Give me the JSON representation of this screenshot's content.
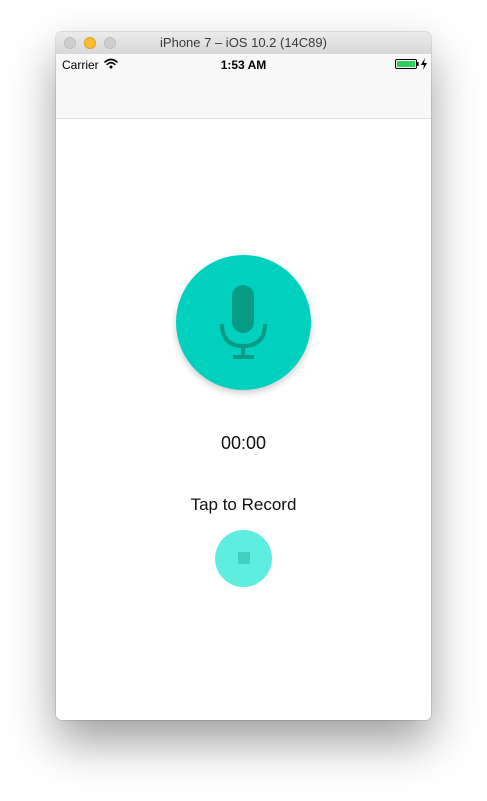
{
  "window": {
    "title": "iPhone 7 – iOS 10.2 (14C89)"
  },
  "status_bar": {
    "carrier": "Carrier",
    "time": "1:53 AM",
    "icons": [
      "wifi-icon",
      "battery-icon",
      "charging-icon"
    ]
  },
  "recorder": {
    "timer": "00:00",
    "prompt": "Tap to Record",
    "record_button_icon": "microphone-icon",
    "stop_button_icon": "stop-icon"
  },
  "colors": {
    "record_button": "#00d1bf",
    "microphone": "#079b85",
    "stop_button": "#5deedf",
    "stop_icon": "#42cfc0",
    "battery": "#2fd158"
  }
}
